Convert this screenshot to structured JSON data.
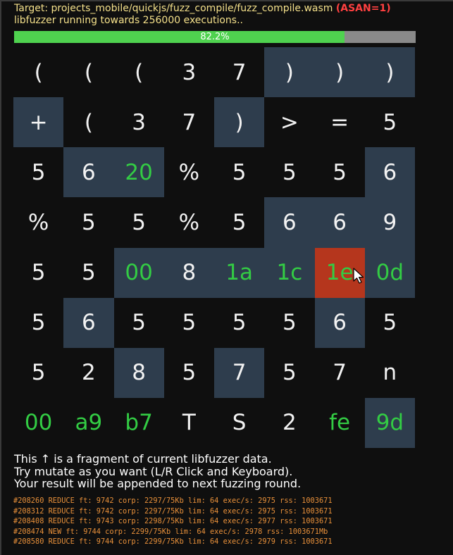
{
  "header": {
    "target_label": "Target: projects_mobile/quickjs/fuzz_compile/fuzz_compile.wasm",
    "asan": "(ASAN=1)",
    "status": "libfuzzer running towards 256000 executions.."
  },
  "progress": {
    "percent": 82.2,
    "label": "82.2%"
  },
  "grid": [
    [
      {
        "t": "(",
        "hl": false,
        "hex": false
      },
      {
        "t": "(",
        "hl": false,
        "hex": false
      },
      {
        "t": "(",
        "hl": false,
        "hex": false
      },
      {
        "t": "3",
        "hl": false,
        "hex": false
      },
      {
        "t": "7",
        "hl": false,
        "hex": false
      },
      {
        "t": ")",
        "hl": true,
        "hex": false
      },
      {
        "t": ")",
        "hl": true,
        "hex": false
      },
      {
        "t": ")",
        "hl": true,
        "hex": false
      }
    ],
    [
      {
        "t": "+",
        "hl": true,
        "hex": false
      },
      {
        "t": "(",
        "hl": false,
        "hex": false
      },
      {
        "t": "3",
        "hl": false,
        "hex": false
      },
      {
        "t": "7",
        "hl": false,
        "hex": false
      },
      {
        "t": ")",
        "hl": true,
        "hex": false
      },
      {
        "t": ">",
        "hl": false,
        "hex": false
      },
      {
        "t": "=",
        "hl": false,
        "hex": false
      },
      {
        "t": "5",
        "hl": false,
        "hex": false
      }
    ],
    [
      {
        "t": "5",
        "hl": false,
        "hex": false
      },
      {
        "t": "6",
        "hl": true,
        "hex": false
      },
      {
        "t": "20",
        "hl": true,
        "hex": true
      },
      {
        "t": "%",
        "hl": false,
        "hex": false
      },
      {
        "t": "5",
        "hl": false,
        "hex": false
      },
      {
        "t": "5",
        "hl": false,
        "hex": false
      },
      {
        "t": "5",
        "hl": false,
        "hex": false
      },
      {
        "t": "6",
        "hl": true,
        "hex": false
      }
    ],
    [
      {
        "t": "%",
        "hl": false,
        "hex": false
      },
      {
        "t": "5",
        "hl": false,
        "hex": false
      },
      {
        "t": "5",
        "hl": false,
        "hex": false
      },
      {
        "t": "%",
        "hl": false,
        "hex": false
      },
      {
        "t": "5",
        "hl": false,
        "hex": false
      },
      {
        "t": "6",
        "hl": true,
        "hex": false
      },
      {
        "t": "6",
        "hl": true,
        "hex": false
      },
      {
        "t": "9",
        "hl": true,
        "hex": false
      }
    ],
    [
      {
        "t": "5",
        "hl": false,
        "hex": false
      },
      {
        "t": "5",
        "hl": false,
        "hex": false
      },
      {
        "t": "00",
        "hl": true,
        "hex": true
      },
      {
        "t": "8",
        "hl": true,
        "hex": false
      },
      {
        "t": "1a",
        "hl": true,
        "hex": true
      },
      {
        "t": "1c",
        "hl": true,
        "hex": true
      },
      {
        "t": "1e",
        "hl": false,
        "hex": true,
        "sel": true
      },
      {
        "t": "0d",
        "hl": true,
        "hex": true
      }
    ],
    [
      {
        "t": "5",
        "hl": false,
        "hex": false
      },
      {
        "t": "6",
        "hl": true,
        "hex": false
      },
      {
        "t": "5",
        "hl": false,
        "hex": false
      },
      {
        "t": "5",
        "hl": false,
        "hex": false
      },
      {
        "t": "5",
        "hl": false,
        "hex": false
      },
      {
        "t": "5",
        "hl": false,
        "hex": false
      },
      {
        "t": "6",
        "hl": true,
        "hex": false
      },
      {
        "t": "5",
        "hl": false,
        "hex": false
      }
    ],
    [
      {
        "t": "5",
        "hl": false,
        "hex": false
      },
      {
        "t": "2",
        "hl": false,
        "hex": false
      },
      {
        "t": "8",
        "hl": true,
        "hex": false
      },
      {
        "t": "5",
        "hl": false,
        "hex": false
      },
      {
        "t": "7",
        "hl": true,
        "hex": false
      },
      {
        "t": "5",
        "hl": false,
        "hex": false
      },
      {
        "t": "7",
        "hl": false,
        "hex": false
      },
      {
        "t": "n",
        "hl": false,
        "hex": false
      }
    ],
    [
      {
        "t": "00",
        "hl": false,
        "hex": true
      },
      {
        "t": "a9",
        "hl": false,
        "hex": true
      },
      {
        "t": "b7",
        "hl": false,
        "hex": true
      },
      {
        "t": "T",
        "hl": false,
        "hex": false
      },
      {
        "t": "S",
        "hl": false,
        "hex": false
      },
      {
        "t": "2",
        "hl": false,
        "hex": false
      },
      {
        "t": "fe",
        "hl": false,
        "hex": true
      },
      {
        "t": "9d",
        "hl": true,
        "hex": true
      }
    ]
  ],
  "info": {
    "line1": "This ↑ is a fragment of current libfuzzer data.",
    "line2": "Try mutate as you want (L/R Click and Keyboard).",
    "line3": "Your result will be appended to next fuzzing round."
  },
  "log": [
    "#208260 REDUCE ft: 9742 corp: 2297/75Kb lim: 64 exec/s: 2975 rss: 1003671",
    "#208312 REDUCE ft: 9742 corp: 2297/75Kb lim: 64 exec/s: 2975 rss: 1003671",
    "#208408 REDUCE ft: 9743 corp: 2298/75Kb lim: 64 exec/s: 2977 rss: 1003671",
    "#208474 NEW ft: 9744 corp: 2299/75Kb lim: 64 exec/s: 2978 rss: 1003671Mb",
    "#208580 REDUCE ft: 9744 corp: 2299/75Kb lim: 64 exec/s: 2979 rss: 1003671"
  ],
  "colors": {
    "hex_text": "#33cc44",
    "highlight": "#2e3d4d",
    "selected": "#b5361d",
    "progress_fill": "#4fd24f",
    "progress_track": "#8a8a8a",
    "log_text": "#e8903a",
    "header_text": "#f4e08a",
    "asan_text": "#ff4040"
  },
  "icons": {
    "cursor": "mouse-pointer-icon"
  }
}
